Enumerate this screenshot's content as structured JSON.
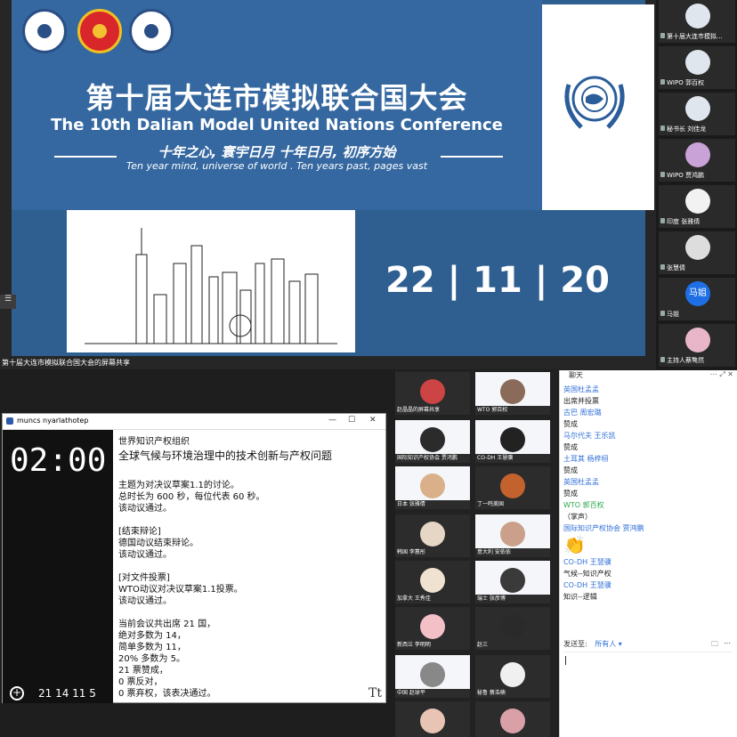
{
  "slide": {
    "title_cn": "第十届大连市模拟联合国大会",
    "title_en": "The 10th Dalian Model United Nations Conference",
    "motto_cn": "十年之心, 寰宇日月  十年日月, 初序方始",
    "motto_en": "Ten year mind, universe of world . Ten years past, pages vast",
    "date": "22 | 11 | 20"
  },
  "share_caption": "第十届大连市模拟联合国大会的屏幕共享",
  "right_participants": [
    {
      "name": "第十届大连市模拟..."
    },
    {
      "name": "WIPO 郭百权"
    },
    {
      "name": "秘书长 刘佳龙"
    },
    {
      "name": "WIPO 贾鸿鹏"
    },
    {
      "name": "印度 张雅倩"
    },
    {
      "name": "张慧倩"
    },
    {
      "name": "马姐",
      "badge": "马姐"
    },
    {
      "name": "主持人蔡骜然"
    }
  ],
  "timer_window": {
    "title": "muncs nyarlathotep",
    "time": "02:00",
    "counts": "21  14  11  5",
    "add_symbol": "+"
  },
  "document": {
    "org": "世界知识产权组织",
    "title": "全球气候与环境治理中的技术创新与产权问题",
    "body": "主题为对决议草案1.1的讨论。\n总时长为 600 秒，每位代表 60 秒。\n该动议通过。\n\n[结束辩论]\n德国动议结束辩论。\n该动议通过。\n\n[对文件投票]\nWTO动议对决议草案1.1投票。\n该动议通过。\n\n当前会议共出席 21 国，\n绝对多数为 14，\n简单多数为 11，\n20% 多数为 5。\n21 票赞成，\n0 票反对，\n0 票弃权，该表决通过。",
    "tt": "Tt"
  },
  "grid_participants": [
    "赵晶晶的屏幕共享",
    "WTO 郭百权",
    "国际知识产权协会 贾鸿鹏",
    "CO-DH 王慧骥",
    "日本 张雅倩",
    "丁一鸣美国",
    "韩国 李蕙彤",
    "意大利 安依依",
    "加拿大 王秀佳",
    "瑞士 张彦博",
    "新西兰 李明明",
    "赵三",
    "中国 赵球平",
    "秘鲁 蔡浩楠"
  ],
  "chat": {
    "title": "聊天",
    "controls": "⋯ ⤢ ✕",
    "messages": [
      {
        "sender": "英国杜孟孟",
        "text": "出席并投票"
      },
      {
        "sender": "古巴 周宏璐",
        "text": "赞成"
      },
      {
        "sender": "马尔代夫 王乐凯",
        "text": "赞成"
      },
      {
        "sender": "土耳其 杨梓栩",
        "text": "赞成"
      },
      {
        "sender": "英国杜孟孟",
        "text": "赞成"
      },
      {
        "sender": "WTO 郭百权",
        "text": "（掌声）",
        "green": true
      },
      {
        "sender": "国际知识产权协会 贾鸿鹏",
        "text": "👏",
        "emoji": true
      },
      {
        "sender": "CO-DH 王慧骥",
        "text": "气候--知识产权"
      },
      {
        "sender": "CO-DH 王慧骥",
        "text": "知识--逻辑"
      }
    ],
    "send_label": "发送至:",
    "send_to": "所有人 ▾"
  }
}
